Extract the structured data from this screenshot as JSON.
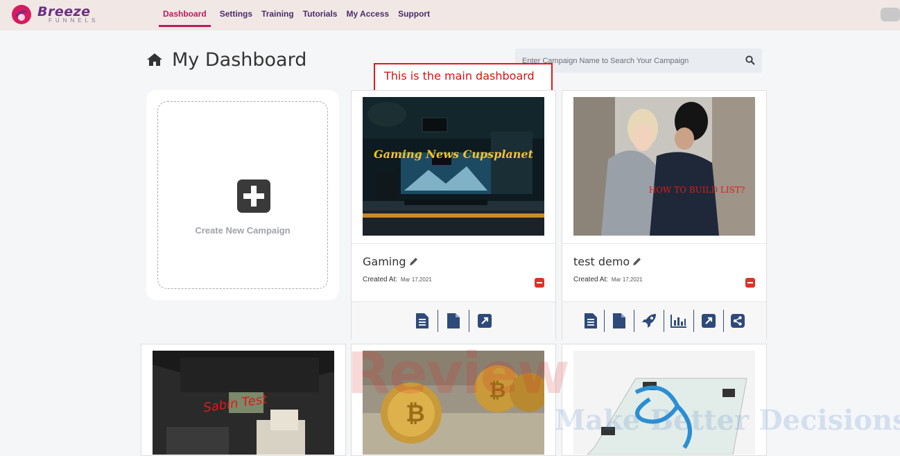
{
  "brand": {
    "name": "Breeze",
    "sub": "FUNNELS"
  },
  "nav": [
    {
      "label": "Dashboard",
      "active": true
    },
    {
      "label": "Settings"
    },
    {
      "label": "Training"
    },
    {
      "label": "Tutorials"
    },
    {
      "label": "My Access"
    },
    {
      "label": "Support"
    }
  ],
  "page": {
    "title": "My Dashboard"
  },
  "search": {
    "placeholder": "Enter Campaign Name to Search Your Campaign"
  },
  "annotation": "This is the main dashboard",
  "create": {
    "label": "Create New Campaign"
  },
  "campaigns": [
    {
      "name": "Gaming",
      "thumb_text": "Gaming News Cupsplanet",
      "created_label": "Created At:",
      "created_value": "Mar 17,2021",
      "actions": [
        "page-icon",
        "file-icon",
        "external-link-icon"
      ]
    },
    {
      "name": "test demo",
      "thumb_text": "HOW TO BUILD LIST?",
      "created_label": "Created At:",
      "created_value": "Mar 17,2021",
      "actions": [
        "page-icon",
        "file-icon",
        "rocket-icon",
        "bar-chart-icon",
        "external-link-icon",
        "share-icon"
      ]
    },
    {
      "thumb_text": "Sabin Test"
    },
    {
      "thumb_text": ""
    },
    {
      "thumb_text": ""
    }
  ],
  "watermark": {
    "line1": "Review",
    "line2": "Make Better Decisions"
  },
  "colors": {
    "accent": "#c2185b",
    "nav": "#4b2a6a",
    "icon": "#2e4a7a",
    "delete": "#d9342b"
  }
}
